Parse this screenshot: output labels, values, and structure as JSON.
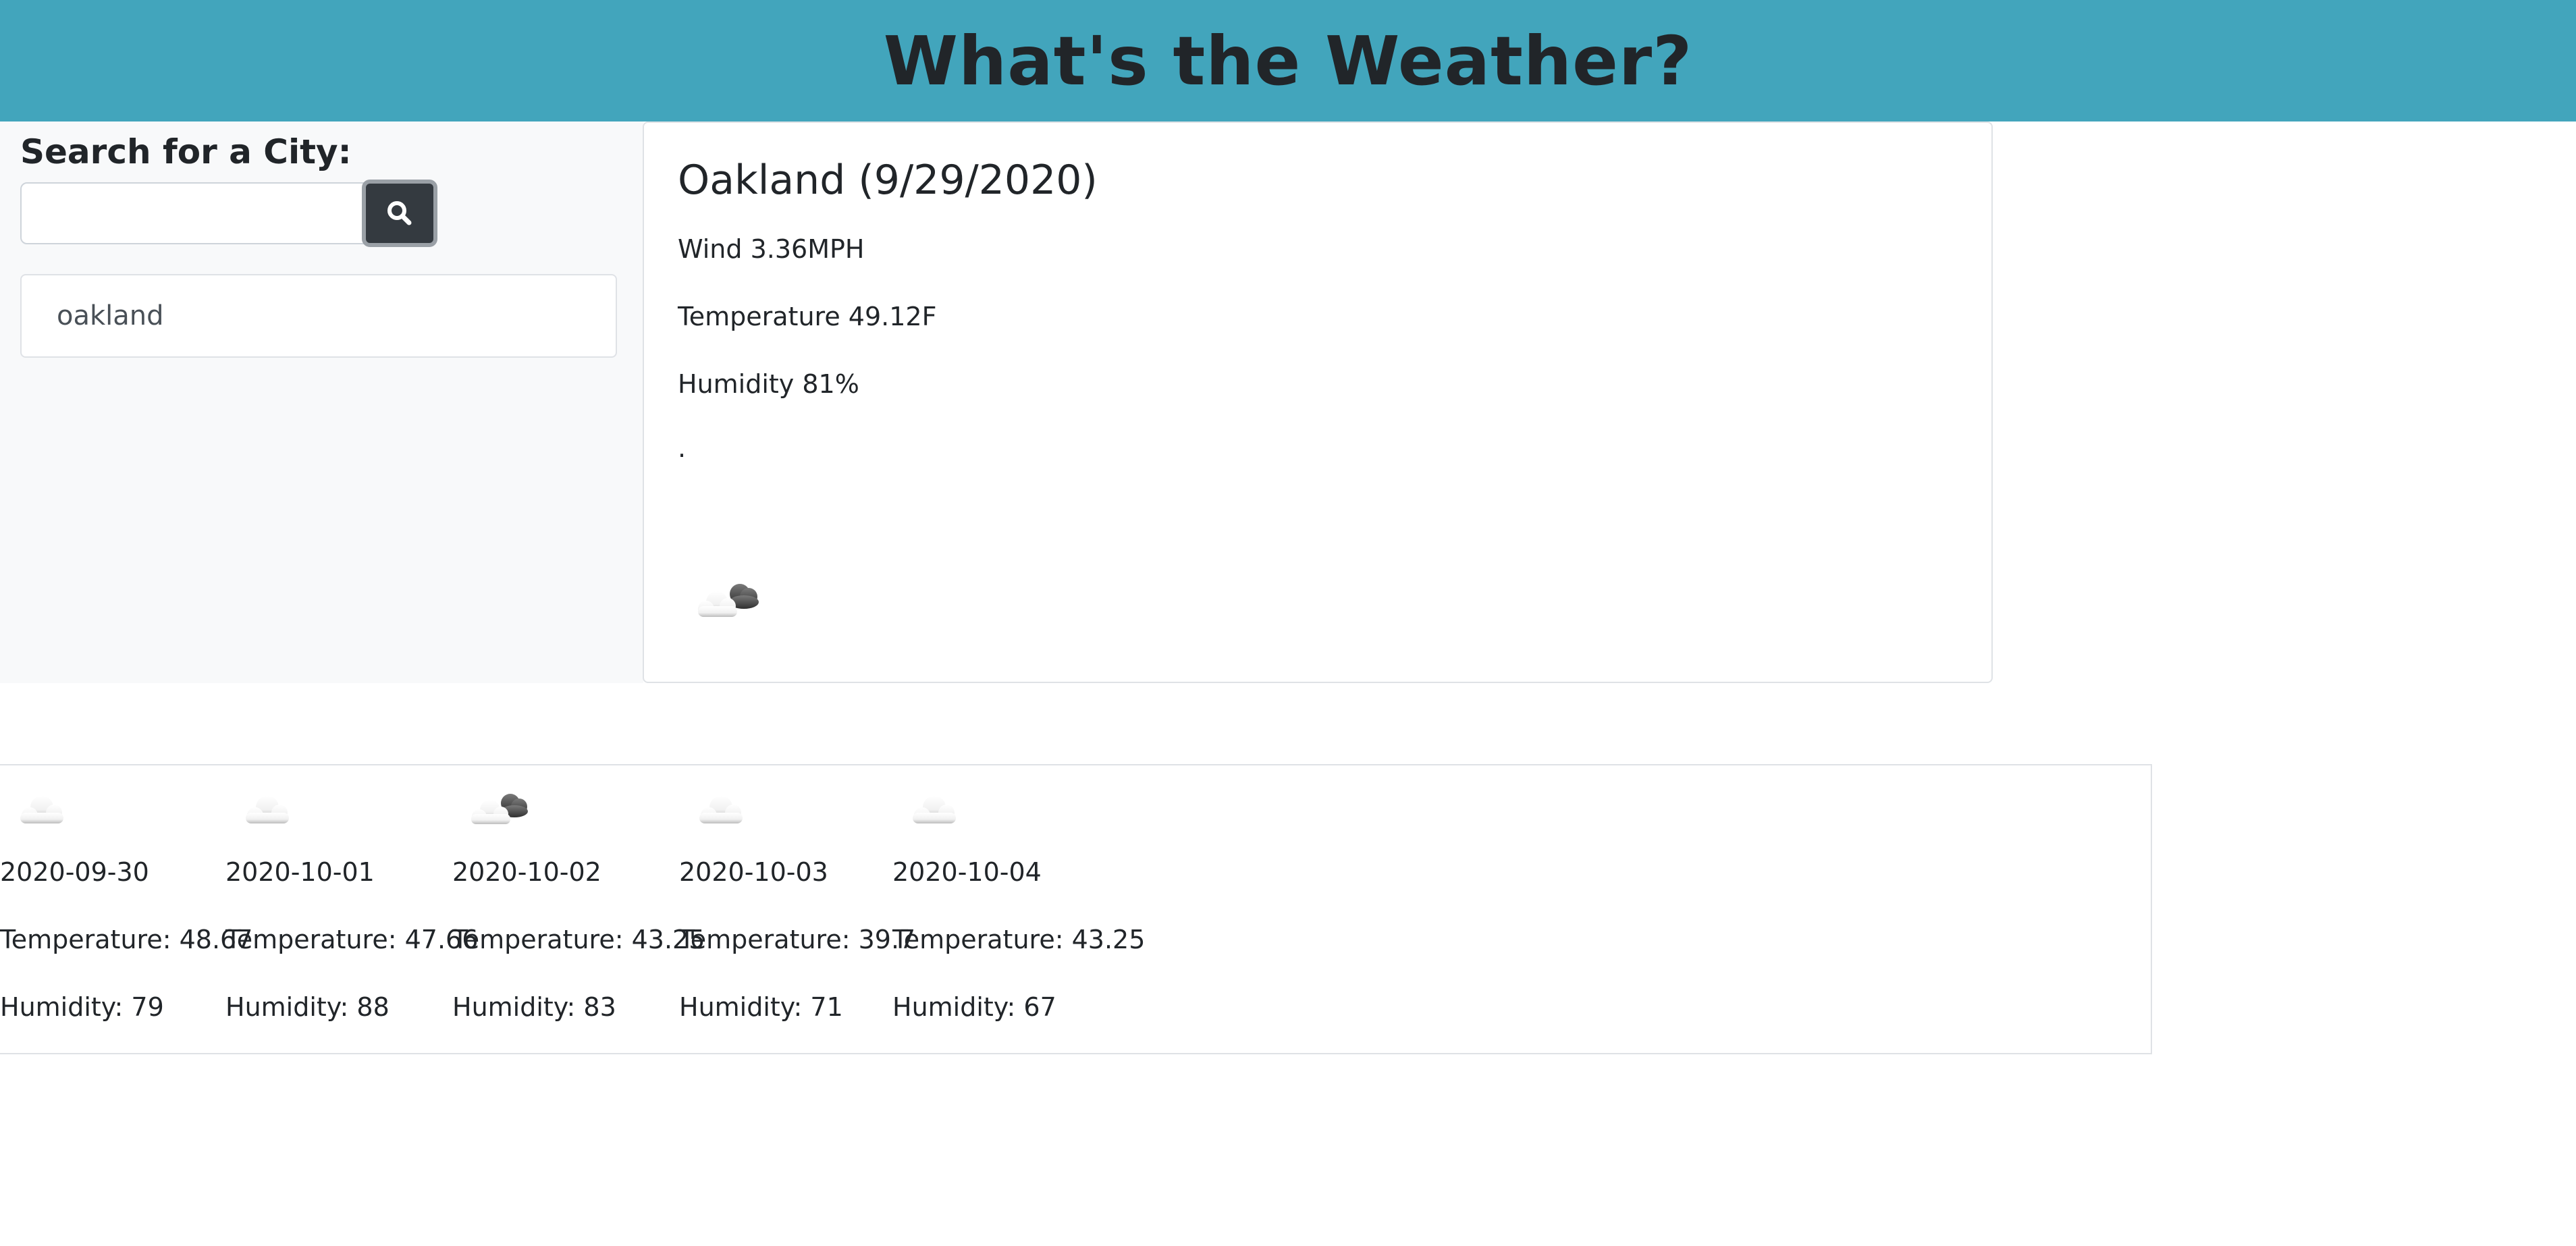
{
  "header": {
    "title": "What's the Weather?"
  },
  "search": {
    "label": "Search for a City:",
    "input_value": "",
    "button_icon": "search-icon"
  },
  "history": {
    "items": [
      {
        "label": "oakland"
      }
    ]
  },
  "current": {
    "title": "Oakland (9/29/2020)",
    "wind": "Wind 3.36MPH",
    "temperature": "Temperature 49.12F",
    "humidity": "Humidity 81%",
    "uv": ".",
    "icon": "broken-clouds-icon"
  },
  "forecast": [
    {
      "date": "2020-09-30",
      "temperature": "Temperature: 48.67",
      "humidity": "Humidity: 79",
      "icon": "cloud-icon"
    },
    {
      "date": "2020-10-01",
      "temperature": "Temperature: 47.66",
      "humidity": "Humidity: 88",
      "icon": "cloud-icon"
    },
    {
      "date": "2020-10-02",
      "temperature": "Temperature: 43.25",
      "humidity": "Humidity: 83",
      "icon": "broken-clouds-icon"
    },
    {
      "date": "2020-10-03",
      "temperature": "Temperature: 39.7",
      "humidity": "Humidity: 71",
      "icon": "cloud-icon"
    },
    {
      "date": "2020-10-04",
      "temperature": "Temperature: 43.25",
      "humidity": "Humidity: 67",
      "icon": "cloud-icon"
    }
  ],
  "colors": {
    "header_bg": "#42a5bc",
    "sidebar_bg": "#f8f9fa",
    "search_button_bg": "#343a40"
  }
}
